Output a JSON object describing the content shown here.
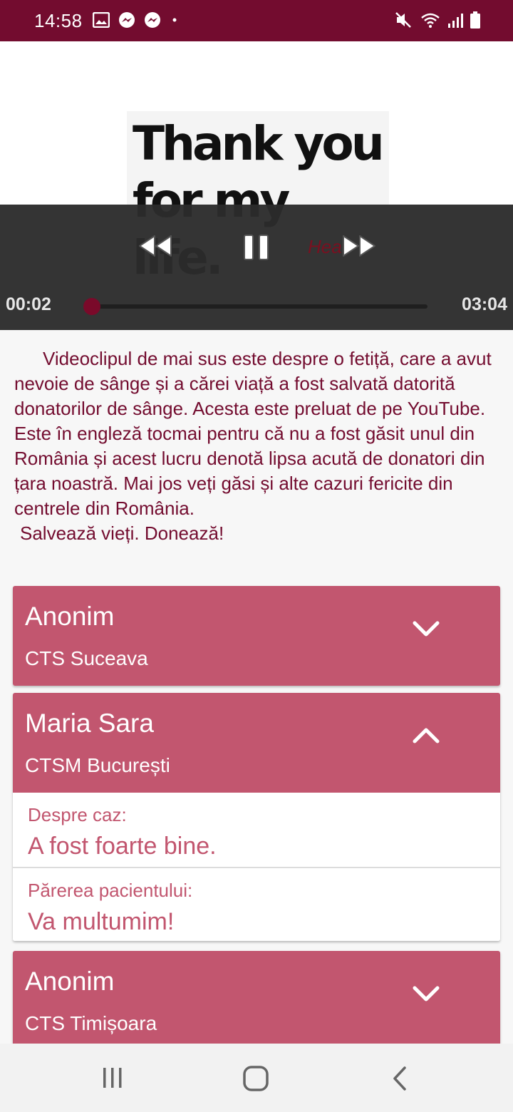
{
  "status_bar": {
    "time": "14:58",
    "left_icons": [
      "image-icon",
      "messenger-icon",
      "messenger-icon",
      "dot-icon"
    ],
    "right_icons": [
      "mute-icon",
      "wifi-icon",
      "signal-icon",
      "battery-icon"
    ],
    "color": "#730c2f"
  },
  "video": {
    "title_line1": "Thank you",
    "title_line2": "for my life.",
    "overlay_text": "Hea",
    "current_time": "00:02",
    "total_time": "03:04",
    "progress": 0.01,
    "controls": [
      "rewind-icon",
      "pause-icon",
      "fast-forward-icon"
    ]
  },
  "description": {
    "paragraph": "Videoclipul de mai sus este despre o fetiță, care a avut nevoie de sânge și a cărei viață a fost salvată datorită donatorilor de sânge. Acesta este preluat de pe YouTube. Este în engleză tocmai pentru că nu a fost găsit unul din România și acest lucru denotă lipsa acută de donatori din țara noastră. Mai jos veți găsi și alte cazuri fericite din centrele din România.",
    "slogan": "Salvează vieți. Donează!"
  },
  "cases": [
    {
      "name": "Anonim",
      "center": "CTS Suceava",
      "expanded": false
    },
    {
      "name": "Maria Sara",
      "center": "CTSM București",
      "expanded": true,
      "details": [
        {
          "label": "Despre caz:",
          "value": "A fost foarte bine."
        },
        {
          "label": "Părerea pacientului:",
          "value": "Va multumim!"
        }
      ]
    },
    {
      "name": "Anonim",
      "center": "CTS Timișoara",
      "expanded": false
    }
  ],
  "nav_bar": {
    "buttons": [
      "recent-apps-icon",
      "home-icon",
      "back-icon"
    ]
  },
  "colors": {
    "accent_dark": "#730c2f",
    "card_header": "#c2566f",
    "text_maroon": "#730c2f"
  }
}
